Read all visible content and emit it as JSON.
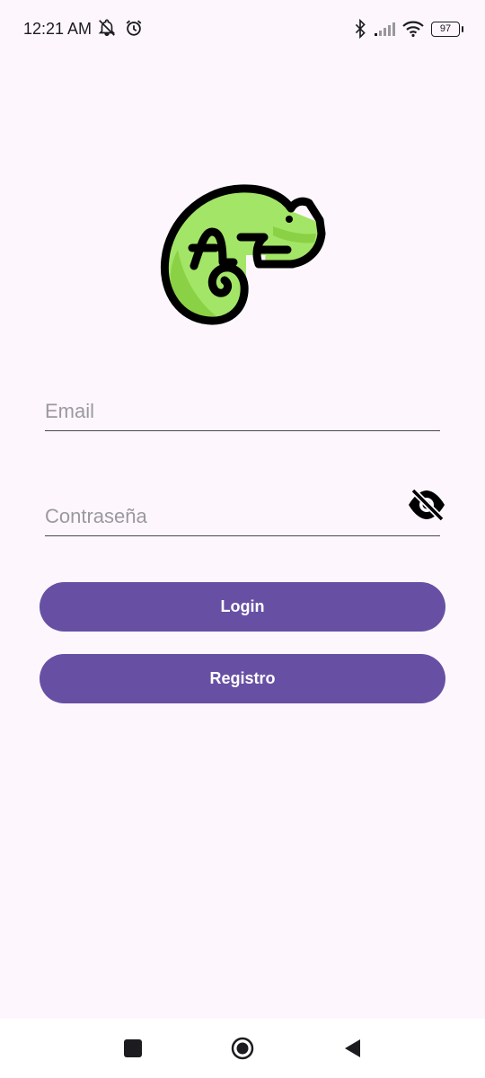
{
  "status_bar": {
    "time": "12:21 AM",
    "battery": "97",
    "icons": [
      "muted-notifications-icon",
      "alarm-icon",
      "bluetooth-icon",
      "cellular-signal-icon",
      "wifi-icon",
      "battery-icon"
    ]
  },
  "logo": {
    "icon": "chameleon-icon",
    "colors": {
      "body": "#a3e567",
      "body_shade": "#8bd145",
      "outline": "#000000"
    }
  },
  "form": {
    "email_placeholder": "Email",
    "email_value": "",
    "password_placeholder": "Contraseña",
    "password_value": "",
    "toggle_icon": "visibility-off-icon"
  },
  "buttons": {
    "login": "Login",
    "register": "Registro"
  },
  "nav_bar": {
    "icons": [
      "recents-square-icon",
      "home-circle-icon",
      "back-triangle-icon"
    ]
  },
  "colors": {
    "background": "#fdf7fd",
    "accent": "#6750a4",
    "button_text": "#ffffff"
  }
}
